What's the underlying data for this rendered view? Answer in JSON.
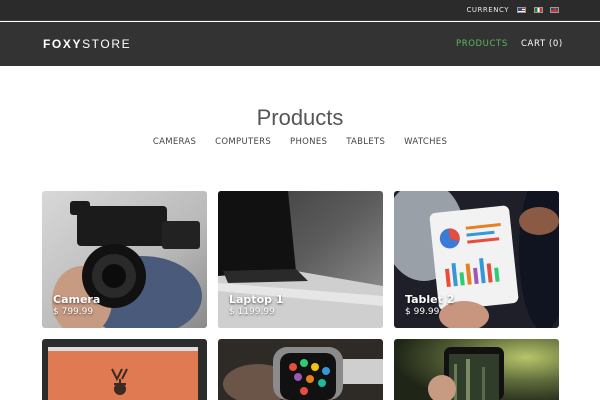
{
  "topbar": {
    "currency_label": "CURRENCY",
    "flags": [
      "us-flag-icon",
      "mx-flag-icon",
      "uk-flag-icon"
    ]
  },
  "header": {
    "logo_bold": "FOXY",
    "logo_light": "STORE",
    "nav": {
      "products": "PRODUCTS",
      "cart": "CART (0)"
    }
  },
  "main": {
    "title": "Products",
    "categories": [
      "CAMERAS",
      "COMPUTERS",
      "PHONES",
      "TABLETS",
      "WATCHES"
    ]
  },
  "products": [
    {
      "name": "Camera",
      "price": "$ 799.99",
      "icon": "camera-photo"
    },
    {
      "name": "Laptop 1",
      "price": "$ 1199.99",
      "icon": "laptop-photo"
    },
    {
      "name": "Tablet 2",
      "price": "$ 99.99",
      "icon": "tablet-photo"
    },
    {
      "icon": "desktop-photo"
    },
    {
      "icon": "smartwatch-photo"
    },
    {
      "icon": "phone-photo"
    }
  ],
  "colors": {
    "topbar_bg": "#2b2b2b",
    "header_bg": "#333333",
    "accent_green": "#5cb85c"
  }
}
